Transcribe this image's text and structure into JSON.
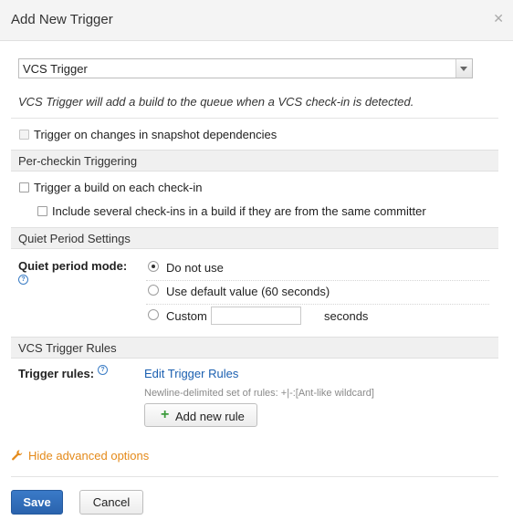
{
  "dialog": {
    "title": "Add New Trigger",
    "close_icon": "close-icon"
  },
  "trigger_type": {
    "selected": "VCS Trigger",
    "description": "VCS Trigger will add a build to the queue when a VCS check-in is detected."
  },
  "snapshot_dependencies": {
    "label": "Trigger on changes in snapshot dependencies",
    "checked": false,
    "disabled": true
  },
  "per_checkin": {
    "section_title": "Per-checkin Triggering",
    "trigger_each_label": "Trigger a build on each check-in",
    "trigger_each_checked": false,
    "include_several_label": "Include several check-ins in a build if they are from the same committer",
    "include_several_checked": false
  },
  "quiet_period": {
    "section_title": "Quiet Period Settings",
    "mode_label": "Quiet period mode:",
    "options": [
      {
        "label": "Do not use",
        "selected": true
      },
      {
        "label": "Use default value (60 seconds)",
        "selected": false
      },
      {
        "label": "Custom",
        "selected": false
      }
    ],
    "custom_value": "",
    "custom_unit": "seconds"
  },
  "rules": {
    "section_title": "VCS Trigger Rules",
    "label": "Trigger rules:",
    "edit_link": "Edit Trigger Rules",
    "hint": "Newline-delimited set of rules: +|-:[Ant-like wildcard]",
    "add_button": "Add new rule"
  },
  "advanced": {
    "toggle_label": "Hide advanced options"
  },
  "footer": {
    "save_label": "Save",
    "cancel_label": "Cancel"
  },
  "colors": {
    "accent": "#2a63ad",
    "link": "#1a5fb0",
    "advanced": "#e48a1a",
    "add_icon": "#3c9b3c"
  }
}
